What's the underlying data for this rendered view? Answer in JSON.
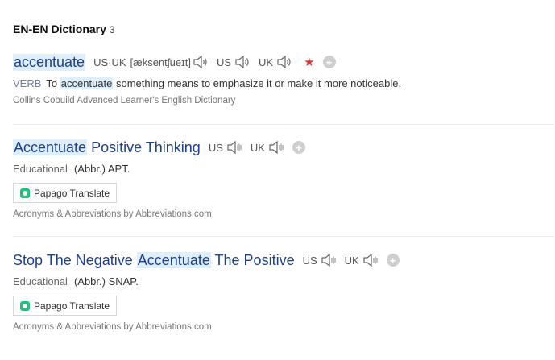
{
  "section": {
    "title": "EN-EN Dictionary",
    "count": "3"
  },
  "entries": [
    {
      "word": "accentuate",
      "ipa_label": "US·UK",
      "ipa": "[æksentʃueɪt]",
      "us_label": "US",
      "uk_label": "UK",
      "pos": "VERB",
      "def_pre": "To",
      "def_hl": "accentuate",
      "def_post": "something means to emphasize it or make it more noticeable.",
      "source": "Collins Cobuild Advanced Learner's English Dictionary",
      "star_color": "#e03131"
    },
    {
      "word_hl": "Accentuate",
      "word_rest": "Positive Thinking",
      "us_label": "US",
      "uk_label": "UK",
      "category": "Educational",
      "abbr": "(Abbr.) APT.",
      "translate_label": "Papago Translate",
      "source": "Acronyms & Abbreviations by Abbreviations.com"
    },
    {
      "word_pre": "Stop The Negative",
      "word_hl": "Accentuate",
      "word_post": "The Positive",
      "us_label": "US",
      "uk_label": "UK",
      "category": "Educational",
      "abbr": "(Abbr.) SNAP.",
      "translate_label": "Papago Translate",
      "source": "Acronyms & Abbreviations by Abbreviations.com"
    }
  ],
  "icons": [
    "speaker-icon",
    "star-icon",
    "plus-icon",
    "papago-logo-icon"
  ]
}
